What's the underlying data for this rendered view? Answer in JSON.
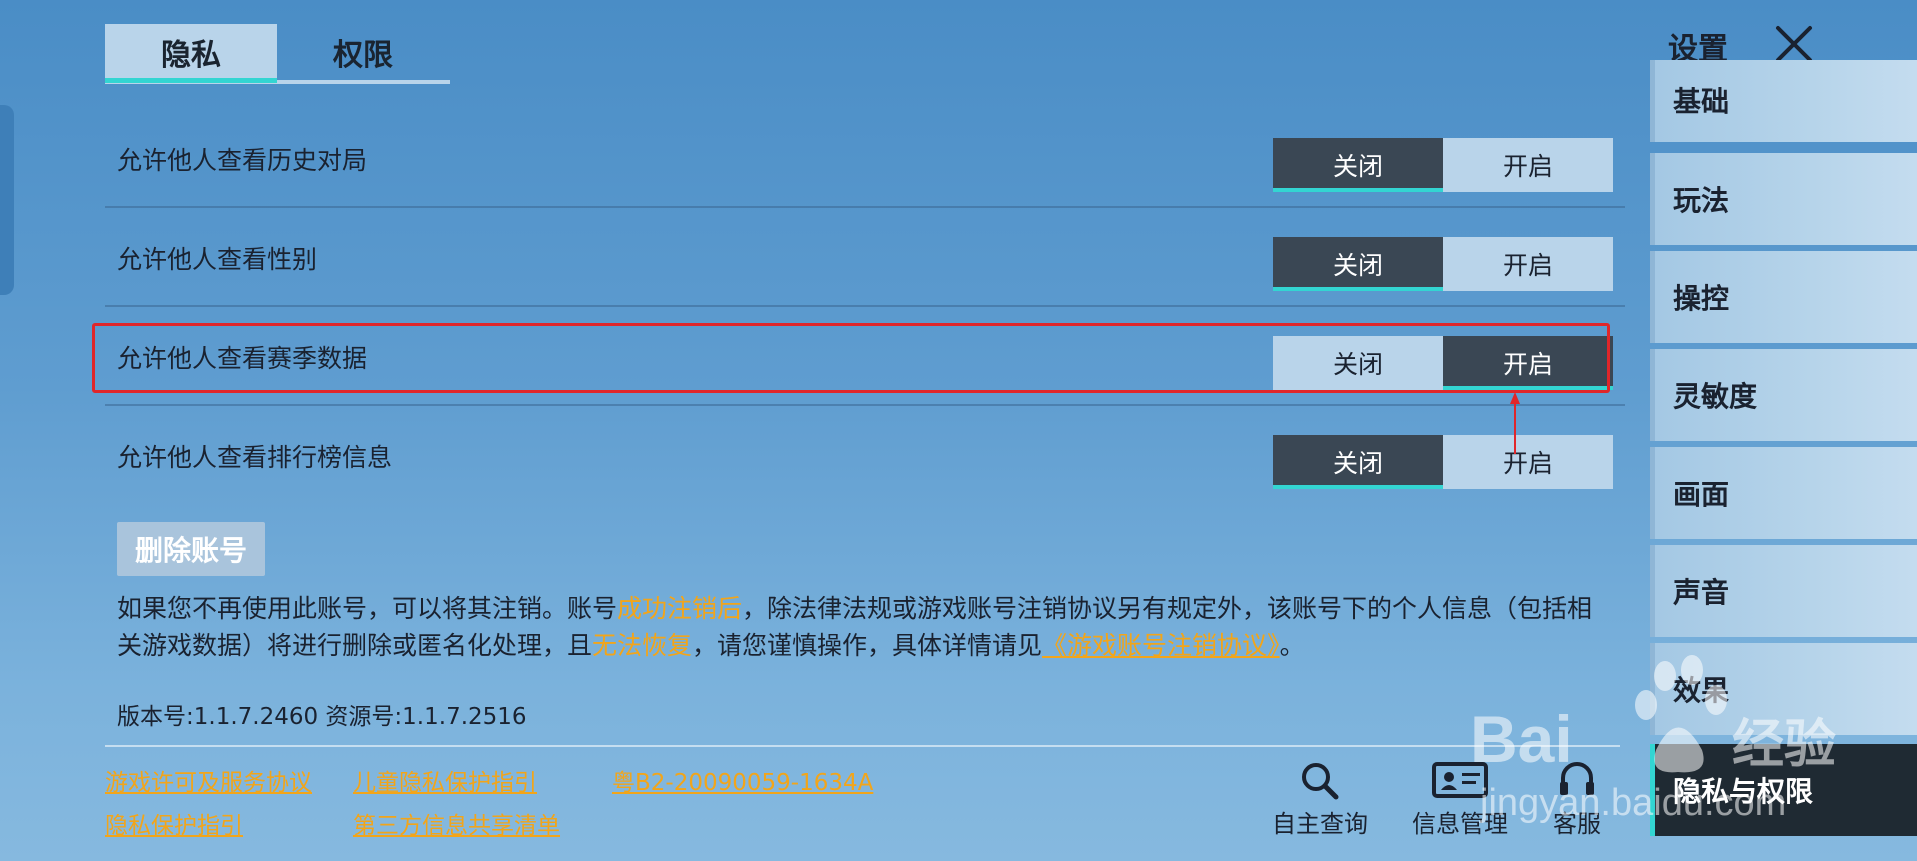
{
  "tabs": {
    "privacy": "隐私",
    "permissions": "权限"
  },
  "rows": [
    {
      "label": "允许他人查看历史对局",
      "off": "关闭",
      "on": "开启",
      "state": "off"
    },
    {
      "label": "允许他人查看性别",
      "off": "关闭",
      "on": "开启",
      "state": "off"
    },
    {
      "label": "允许他人查看赛季数据",
      "off": "关闭",
      "on": "开启",
      "state": "on"
    },
    {
      "label": "允许他人查看排行榜信息",
      "off": "关闭",
      "on": "开启",
      "state": "off"
    }
  ],
  "delete_account": {
    "button": "删除账号",
    "desc_1": "如果您不再使用此账号，可以将其注销。账号",
    "desc_hl1": "成功注销后",
    "desc_2": "，除法律法规或游戏账号注销协议另有规定外，该账号下的个人信息（包括相关游戏数据）将进行删除或匿名化处理，且",
    "desc_hl2": "无法恢复",
    "desc_3": "，请您谨慎操作，具体详情请见",
    "desc_link": "《游戏账号注销协议》",
    "desc_4": "。"
  },
  "version": "版本号:1.1.7.2460 资源号:1.1.7.2516",
  "footer_links": {
    "service": "游戏许可及服务协议",
    "children": "儿童隐私保护指引",
    "icp": "粤B2-20090059-1634A",
    "privacy": "隐私保护指引",
    "third_party": "第三方信息共享清单"
  },
  "footer_icons": {
    "query": "自主查询",
    "info": "信息管理",
    "service": "客服"
  },
  "sidebar": {
    "title": "设置",
    "items": [
      "基础",
      "玩法",
      "操控",
      "灵敏度",
      "画面",
      "声音",
      "效果",
      "隐私与权限"
    ],
    "active": "隐私与权限"
  },
  "watermark": {
    "brand": "Bai",
    "brand_cn": "经验",
    "url": "jingyan.baidu.com"
  },
  "colors": {
    "accent": "#33d5d2",
    "link": "#f2a51a",
    "highlight": "#e0262a",
    "toggle_on": "#3a4754"
  },
  "icons": [
    "search-icon",
    "id-card-icon",
    "headset-icon",
    "close-icon"
  ]
}
